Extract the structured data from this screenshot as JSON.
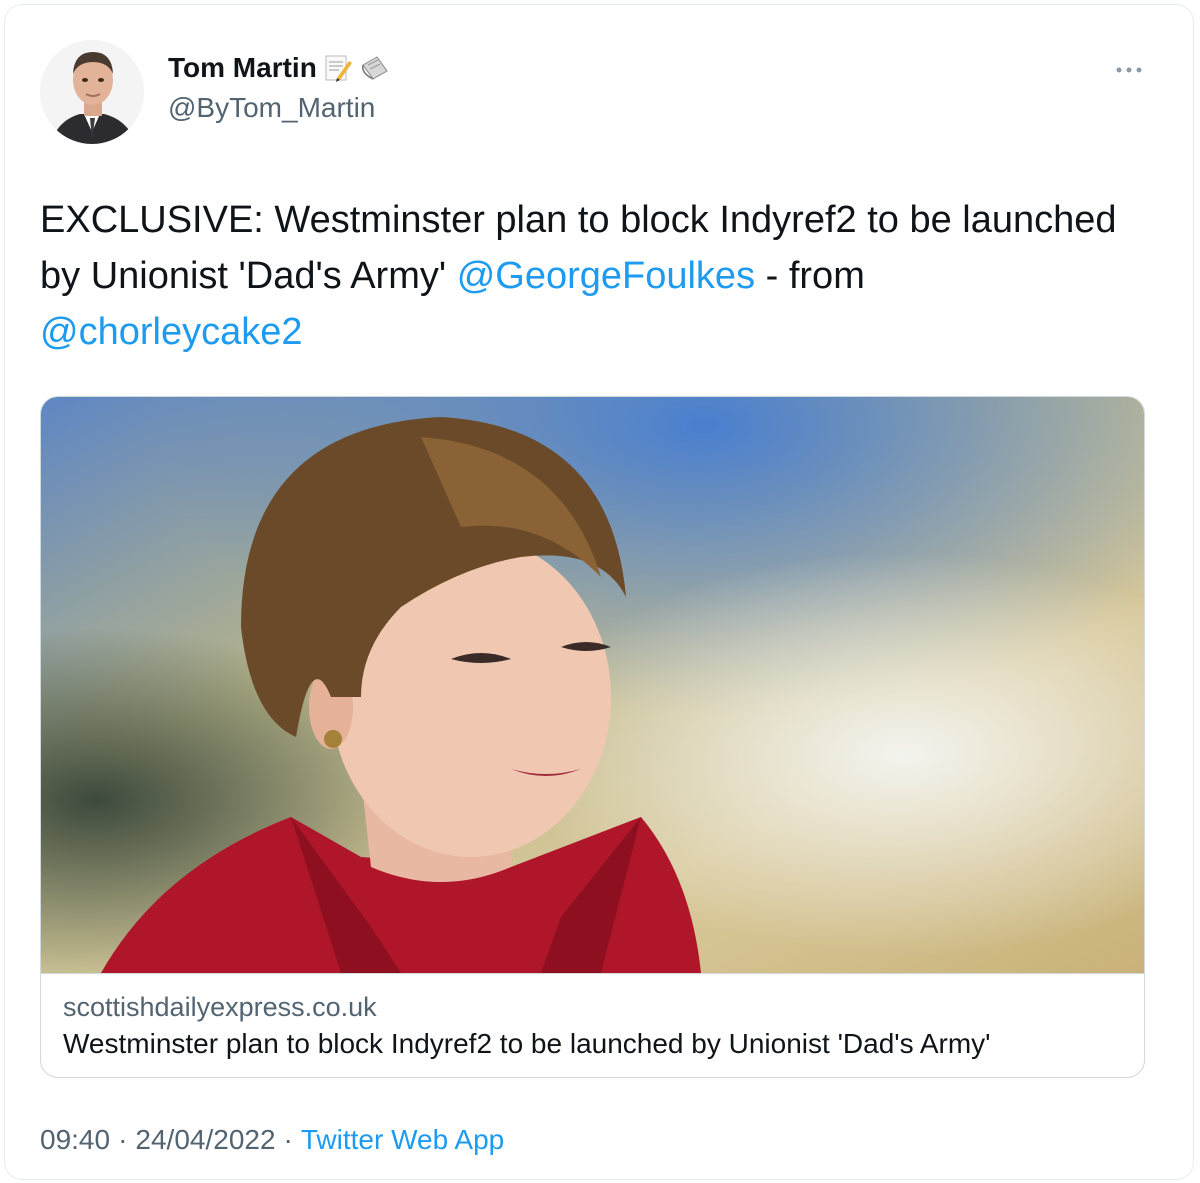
{
  "author": {
    "display_name": "Tom Martin",
    "handle": "@ByTom_Martin",
    "badges": [
      "memo-icon",
      "newspaper-icon"
    ]
  },
  "menu": {
    "more_icon": "more-options-icon"
  },
  "tweet": {
    "text_part1": "EXCLUSIVE: Westminster plan to block Indyref2 to be launched by Unionist 'Dad's Army' ",
    "mention1": "@GeorgeFoulkes",
    "text_part2": " - from ",
    "mention2": "@chorleycake2"
  },
  "link_card": {
    "domain": "scottishdailyexpress.co.uk",
    "title": "Westminster plan to block Indyref2 to be launched by Unionist 'Dad's Army'"
  },
  "footer": {
    "time": "09:40",
    "date": "24/04/2022",
    "separator": "·",
    "source": "Twitter Web App"
  },
  "colors": {
    "link": "#1d9bf0",
    "secondary_text": "#536471",
    "primary_text": "#0f1419",
    "border": "#cfd9de"
  }
}
